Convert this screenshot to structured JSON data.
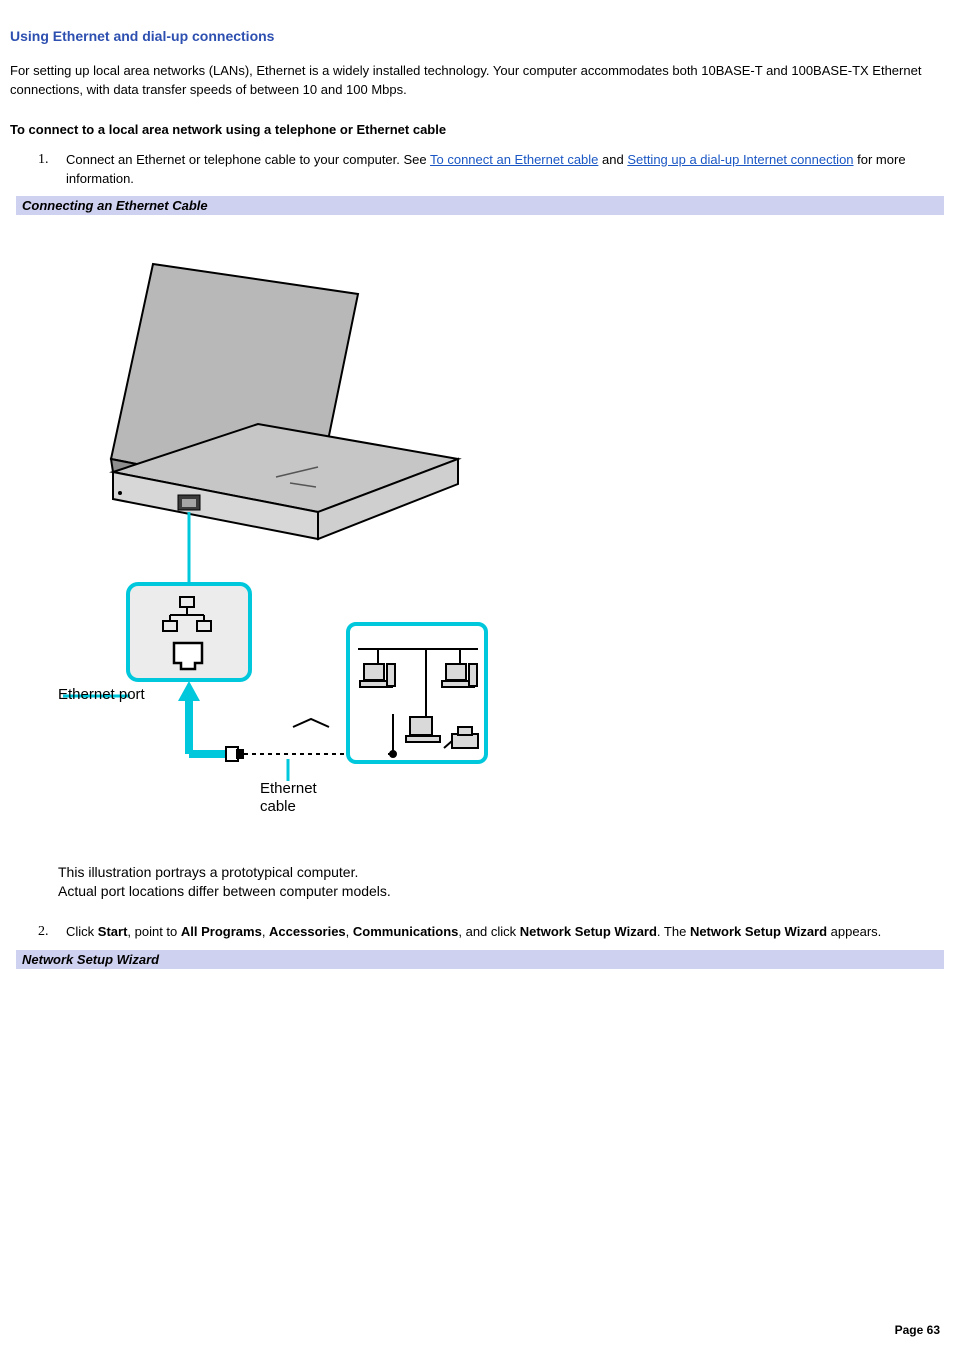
{
  "heading": "Using Ethernet and dial-up connections",
  "intro": "For setting up local area networks (LANs), Ethernet is a widely installed technology. Your computer accommodates both 10BASE-T and 100BASE-TX Ethernet connections, with data transfer speeds of between 10 and 100 Mbps.",
  "subheading": "To connect to a local area network using a telephone or Ethernet cable",
  "step1": {
    "num": "1.",
    "pre": "Connect an Ethernet or telephone cable to your computer. See ",
    "link1": "To connect an Ethernet cable",
    "mid": " and ",
    "link2": "Setting up a dial-up Internet connection",
    "post": " for more information."
  },
  "caption1": "Connecting an Ethernet Cable",
  "fig_labels": {
    "port": "Ethernet port",
    "cable_l1": "Ethernet",
    "cable_l2": "cable"
  },
  "illus_note_l1": "This illustration portrays a prototypical computer.",
  "illus_note_l2": "Actual port locations differ between computer models.",
  "step2": {
    "num": "2.",
    "t0": "Click ",
    "b0": "Start",
    "t1": ", point to ",
    "b1": "All Programs",
    "t2": ", ",
    "b2": "Accessories",
    "t3": ", ",
    "b3": "Communications",
    "t4": ", and click ",
    "b4": "Network Setup Wizard",
    "t5": ". The ",
    "b5": "Network Setup Wizard",
    "t6": " appears."
  },
  "caption2": "Network Setup Wizard",
  "page_footer": "Page 63"
}
